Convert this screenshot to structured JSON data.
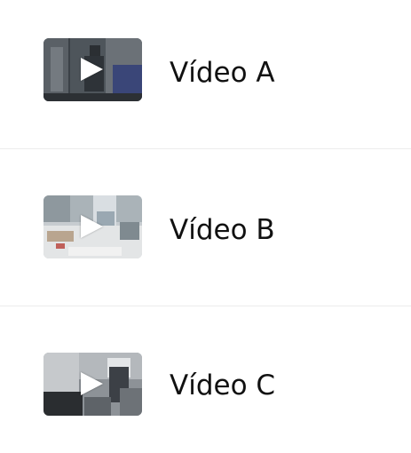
{
  "videos": [
    {
      "title": "Vídeo A",
      "thumbnail_icon": "video-thumbnail"
    },
    {
      "title": "Vídeo B",
      "thumbnail_icon": "video-thumbnail"
    },
    {
      "title": "Vídeo C",
      "thumbnail_icon": "video-thumbnail"
    }
  ],
  "colors": {
    "divider": "#ececec",
    "text": "#111111",
    "play_icon": "#ffffff"
  }
}
